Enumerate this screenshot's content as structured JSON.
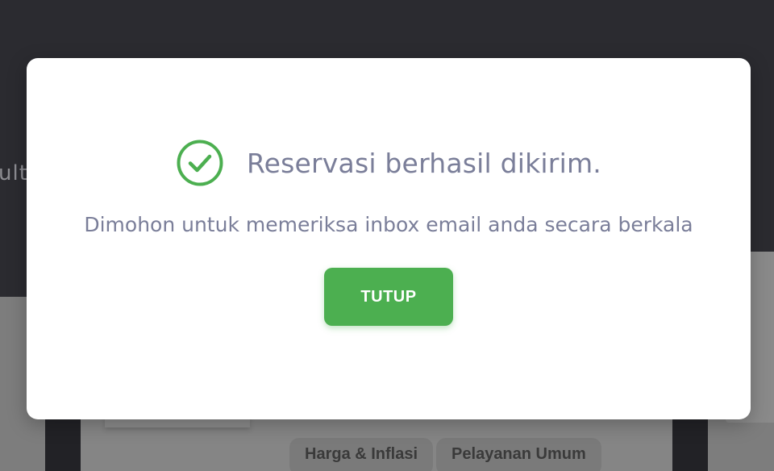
{
  "background": {
    "hero_text": "ult",
    "tags": [
      "Harga & Inflasi",
      "Pelayanan Umum"
    ]
  },
  "modal": {
    "icon": "check-circle-icon",
    "title": "Reservasi berhasil dikirim.",
    "message": "Dimohon untuk memeriksa inbox email anda secara berkala",
    "close_label": "TUTUP",
    "accent_color": "#4caf50",
    "text_color": "#7a7e99"
  }
}
